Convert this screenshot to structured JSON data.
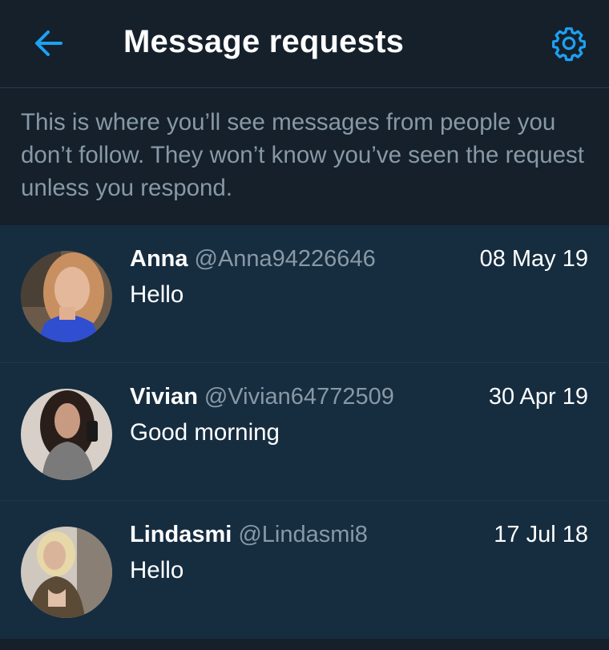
{
  "header": {
    "title": "Message requests",
    "back_icon": "arrow-left-icon",
    "settings_icon": "gear-icon",
    "accent_color": "#1da1f2"
  },
  "info_text": "This is where you’ll see messages from people you don’t follow. They won’t know you’ve seen the request unless you respond.",
  "requests": [
    {
      "name": "Anna",
      "handle": "@Anna94226646",
      "date": "08 May 19",
      "message": "Hello"
    },
    {
      "name": "Vivian",
      "handle": "@Vivian64772509",
      "date": "30 Apr 19",
      "message": "Good morning"
    },
    {
      "name": "Lindasmi",
      "handle": "@Lindasmi8",
      "date": "17 Jul 18",
      "message": "Hello"
    }
  ]
}
